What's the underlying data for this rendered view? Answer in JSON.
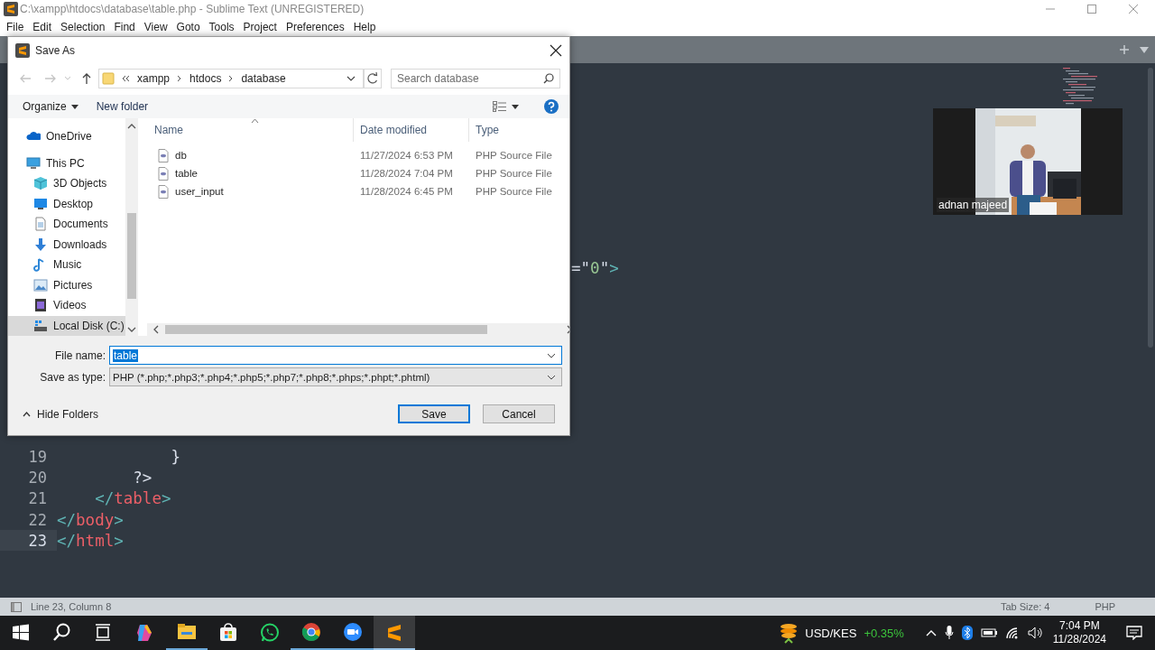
{
  "window": {
    "title": "C:\\xampp\\htdocs\\database\\table.php - Sublime Text (UNREGISTERED)"
  },
  "menu": [
    "File",
    "Edit",
    "Selection",
    "Find",
    "View",
    "Goto",
    "Tools",
    "Project",
    "Preferences",
    "Help"
  ],
  "editor": {
    "fragment": {
      "tokens": [
        {
          "kind": "plain",
          "text": "="
        },
        {
          "kind": "plain",
          "text": "\""
        },
        {
          "kind": "string",
          "text": "0"
        },
        {
          "kind": "plain",
          "text": "\""
        },
        {
          "kind": "punct",
          "text": ">"
        }
      ]
    },
    "lines": [
      {
        "number": "19",
        "current": false,
        "tokens": [
          {
            "kind": "plain",
            "text": "            }"
          }
        ]
      },
      {
        "number": "20",
        "current": false,
        "tokens": [
          {
            "kind": "plain",
            "text": "        ?>"
          }
        ]
      },
      {
        "number": "21",
        "current": false,
        "tokens": [
          {
            "kind": "punct",
            "text": "    </"
          },
          {
            "kind": "tag",
            "text": "table"
          },
          {
            "kind": "punct",
            "text": ">"
          }
        ]
      },
      {
        "number": "22",
        "current": false,
        "tokens": [
          {
            "kind": "punct",
            "text": "</"
          },
          {
            "kind": "tag",
            "text": "body"
          },
          {
            "kind": "punct",
            "text": ">"
          }
        ]
      },
      {
        "number": "23",
        "current": true,
        "tokens": [
          {
            "kind": "punct",
            "text": "</"
          },
          {
            "kind": "tag",
            "text": "html"
          },
          {
            "kind": "punct",
            "text": ">"
          }
        ]
      }
    ]
  },
  "video_tile": {
    "name": "adnan majeed"
  },
  "dialog": {
    "title": "Save As",
    "path": [
      "xampp",
      "htdocs",
      "database"
    ],
    "search": {
      "placeholder": "Search database"
    },
    "toolbar": {
      "organize": "Organize",
      "new_folder": "New folder"
    },
    "nav": [
      {
        "label": "OneDrive",
        "kind": "onedrive",
        "selected": false
      },
      {
        "label": "This PC",
        "kind": "pc",
        "selected": false,
        "children": [
          {
            "label": "3D Objects",
            "kind": "objects",
            "selected": false
          },
          {
            "label": "Desktop",
            "kind": "desktop",
            "selected": false
          },
          {
            "label": "Documents",
            "kind": "documents",
            "selected": false
          },
          {
            "label": "Downloads",
            "kind": "downloads",
            "selected": false
          },
          {
            "label": "Music",
            "kind": "music",
            "selected": false
          },
          {
            "label": "Pictures",
            "kind": "pictures",
            "selected": false
          },
          {
            "label": "Videos",
            "kind": "videos",
            "selected": false
          },
          {
            "label": "Local Disk (C:)",
            "kind": "disk",
            "selected": true
          }
        ]
      }
    ],
    "columns": [
      "Name",
      "Date modified",
      "Type"
    ],
    "files": [
      {
        "name": "db",
        "date": "11/27/2024 6:53 PM",
        "type": "PHP Source File"
      },
      {
        "name": "table",
        "date": "11/28/2024 7:04 PM",
        "type": "PHP Source File"
      },
      {
        "name": "user_input",
        "date": "11/28/2024 6:45 PM",
        "type": "PHP Source File"
      }
    ],
    "file_name": {
      "label": "File name:",
      "value": "table"
    },
    "save_type": {
      "label": "Save as type:",
      "value": "PHP (*.php;*.php3;*.php4;*.php5;*.php7;*.php8;*.phps;*.phpt;*.phtml)"
    },
    "hide_folders": "Hide Folders",
    "buttons": [
      {
        "label": "Save",
        "default": true
      },
      {
        "label": "Cancel",
        "default": false
      }
    ]
  },
  "status_bar": {
    "position": "Line 23, Column 8",
    "tab_size": "Tab Size: 4",
    "syntax": "PHP"
  },
  "taskbar": {
    "apps": [
      {
        "kind": "start",
        "running": false,
        "active": false
      },
      {
        "kind": "search",
        "running": false,
        "active": false
      },
      {
        "kind": "taskview",
        "running": false,
        "active": false
      },
      {
        "kind": "copilot",
        "running": false,
        "active": false
      },
      {
        "kind": "explorer",
        "running": true,
        "active": false
      },
      {
        "kind": "store",
        "running": false,
        "active": false
      },
      {
        "kind": "whatsapp",
        "running": false,
        "active": false
      },
      {
        "kind": "chrome",
        "running": true,
        "active": false
      },
      {
        "kind": "zoom",
        "running": true,
        "active": false
      },
      {
        "kind": "sublime",
        "running": true,
        "active": true
      }
    ],
    "ticker": {
      "symbol": "USD/KES",
      "change": "+0.35%"
    },
    "time": "7:04 PM",
    "date": "11/28/2024"
  }
}
